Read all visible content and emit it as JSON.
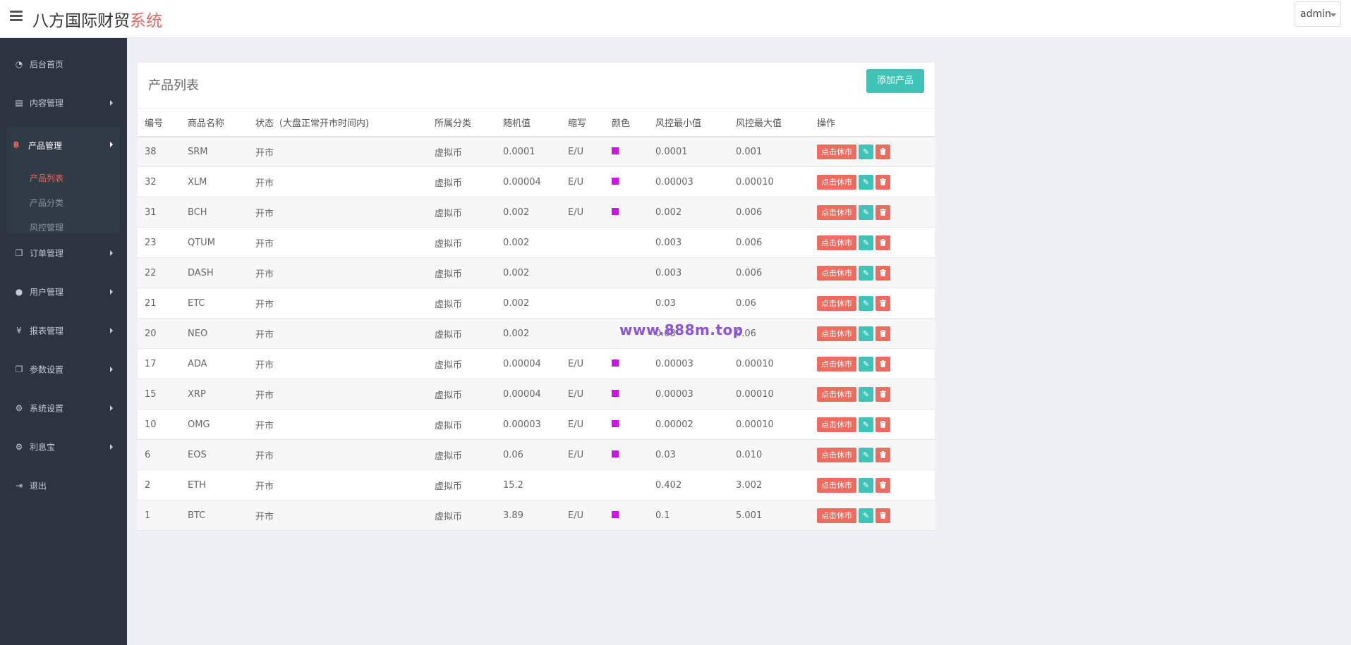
{
  "header": {
    "brand_main": "八方国际财贸",
    "brand_accent": "系统",
    "user": "admin"
  },
  "sidebar": {
    "items": [
      {
        "label": "后台首页",
        "icon": "dashboard-icon"
      },
      {
        "label": "内容管理",
        "icon": "book-icon"
      },
      {
        "label": "订单管理",
        "icon": "copy-icon"
      },
      {
        "label": "用户管理",
        "icon": "user-icon"
      },
      {
        "label": "报表管理",
        "icon": "yen-icon"
      },
      {
        "label": "参数设置",
        "icon": "copy-icon"
      },
      {
        "label": "系统设置",
        "icon": "gears-icon"
      },
      {
        "label": "利息宝",
        "icon": "gears-icon"
      },
      {
        "label": "退出",
        "icon": "sign-out-icon"
      }
    ],
    "active_group": {
      "label": "产品管理",
      "icon": "bitcoin-icon",
      "subitems": [
        "产品列表",
        "产品分类",
        "风控管理"
      ]
    }
  },
  "panel": {
    "title": "产品列表",
    "add_label": "添加产品"
  },
  "table": {
    "headers": [
      "编号",
      "商品名称",
      "状态（大盘正常开市时间内)",
      "所属分类",
      "随机值",
      "缩写",
      "颜色",
      "风控最小值",
      "风控最大值",
      "操作"
    ],
    "action_label": "点击休市",
    "rows": [
      {
        "id": "38",
        "name": "SRM",
        "status": "开市",
        "category": "虚拟币",
        "random": "0.0001",
        "abbr": "E/U",
        "color": true,
        "min": "0.0001",
        "max": "0.001"
      },
      {
        "id": "32",
        "name": "XLM",
        "status": "开市",
        "category": "虚拟币",
        "random": "0.00004",
        "abbr": "E/U",
        "color": true,
        "min": "0.00003",
        "max": "0.00010"
      },
      {
        "id": "31",
        "name": "BCH",
        "status": "开市",
        "category": "虚拟币",
        "random": "0.002",
        "abbr": "E/U",
        "color": true,
        "min": "0.002",
        "max": "0.006"
      },
      {
        "id": "23",
        "name": "QTUM",
        "status": "开市",
        "category": "虚拟币",
        "random": "0.002",
        "abbr": "",
        "color": false,
        "min": "0.003",
        "max": "0.006"
      },
      {
        "id": "22",
        "name": "DASH",
        "status": "开市",
        "category": "虚拟币",
        "random": "0.002",
        "abbr": "",
        "color": false,
        "min": "0.003",
        "max": "0.006"
      },
      {
        "id": "21",
        "name": "ETC",
        "status": "开市",
        "category": "虚拟币",
        "random": "0.002",
        "abbr": "",
        "color": false,
        "min": "0.03",
        "max": "0.06"
      },
      {
        "id": "20",
        "name": "NEO",
        "status": "开市",
        "category": "虚拟币",
        "random": "0.002",
        "abbr": "",
        "color": false,
        "min": "0.03",
        "max": "0.06"
      },
      {
        "id": "17",
        "name": "ADA",
        "status": "开市",
        "category": "虚拟币",
        "random": "0.00004",
        "abbr": "E/U",
        "color": true,
        "min": "0.00003",
        "max": "0.00010"
      },
      {
        "id": "15",
        "name": "XRP",
        "status": "开市",
        "category": "虚拟币",
        "random": "0.00004",
        "abbr": "E/U",
        "color": true,
        "min": "0.00003",
        "max": "0.00010"
      },
      {
        "id": "10",
        "name": "OMG",
        "status": "开市",
        "category": "虚拟币",
        "random": "0.00003",
        "abbr": "E/U",
        "color": true,
        "min": "0.00002",
        "max": "0.00010"
      },
      {
        "id": "6",
        "name": "EOS",
        "status": "开市",
        "category": "虚拟币",
        "random": "0.06",
        "abbr": "E/U",
        "color": true,
        "min": "0.03",
        "max": "0.010"
      },
      {
        "id": "2",
        "name": "ETH",
        "status": "开市",
        "category": "虚拟币",
        "random": "15.2",
        "abbr": "",
        "color": false,
        "min": "0.402",
        "max": "3.002"
      },
      {
        "id": "1",
        "name": "BTC",
        "status": "开市",
        "category": "虚拟币",
        "random": "3.89",
        "abbr": "E/U",
        "color": true,
        "min": "0.1",
        "max": "5.001"
      }
    ],
    "swatch_color": "#cc14e8"
  },
  "watermark": "www.888m.top"
}
